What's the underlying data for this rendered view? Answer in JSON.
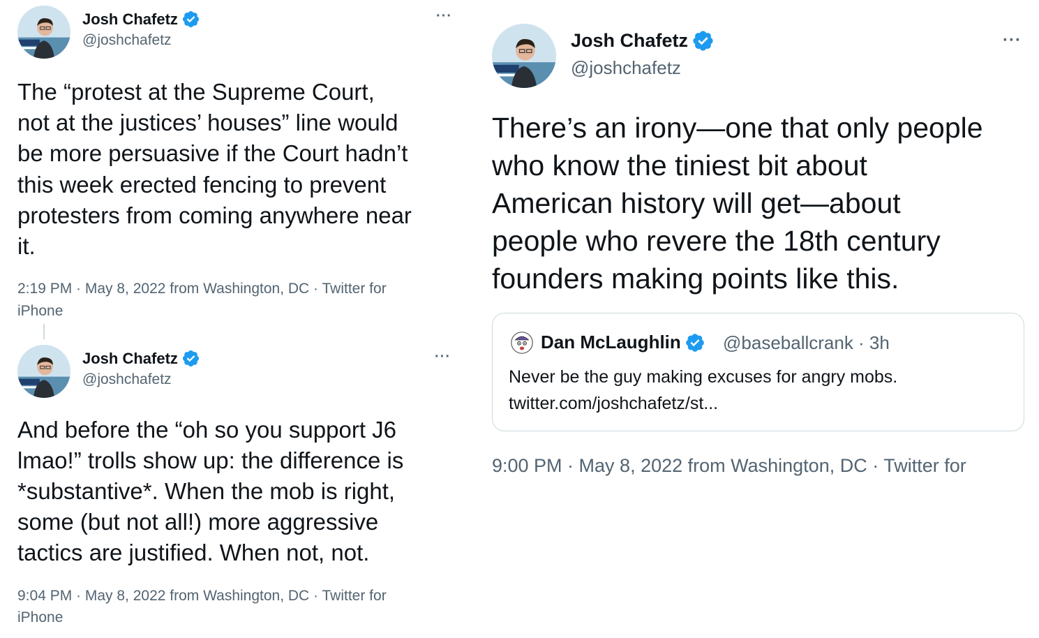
{
  "tweets": [
    {
      "author_name": "Josh Chafetz",
      "author_handle": "@joshchafetz",
      "text": "The “protest at the Supreme Court,\nnot at the justices’ houses” line would\nbe more persuasive if the Court hadn’t\nthis week erected fencing to prevent\nprotesters from coming anywhere near\nit.",
      "meta": "2:19 PM · May 8, 2022 from Washington, DC · Twitter for\niPhone",
      "more": "···"
    },
    {
      "author_name": "Josh Chafetz",
      "author_handle": "@joshchafetz",
      "text": "And before the “oh so you support J6\nlmao!” trolls show up: the difference is\n*substantive*. When the mob is right,\nsome (but not all!) more aggressive\ntactics are justified. When not, not.",
      "meta": "9:04 PM · May 8, 2022 from Washington, DC · Twitter for\niPhone",
      "more": "···"
    },
    {
      "author_name": "Josh Chafetz",
      "author_handle": "@joshchafetz",
      "text": "There’s an irony—one that only people\nwho know the tiniest bit about\nAmerican history will get—about\npeople who revere the 18th century\nfounders making points like this.",
      "meta": "9:00 PM · May 8, 2022 from Washington, DC · Twitter for",
      "more": "···",
      "quote": {
        "author_name": "Dan McLaughlin",
        "author_handle": "@baseballcrank · 3h",
        "text": "Never be the guy making excuses for angry mobs.\ntwitter.com/joshchafetz/st..."
      }
    }
  ],
  "colors": {
    "verified": "#1d9bf0",
    "secondary_text": "#536471",
    "primary_text": "#0f1419",
    "border": "#cfd9de"
  },
  "icons": {
    "verified": "verified-badge-icon",
    "more": "more-options-icon"
  }
}
